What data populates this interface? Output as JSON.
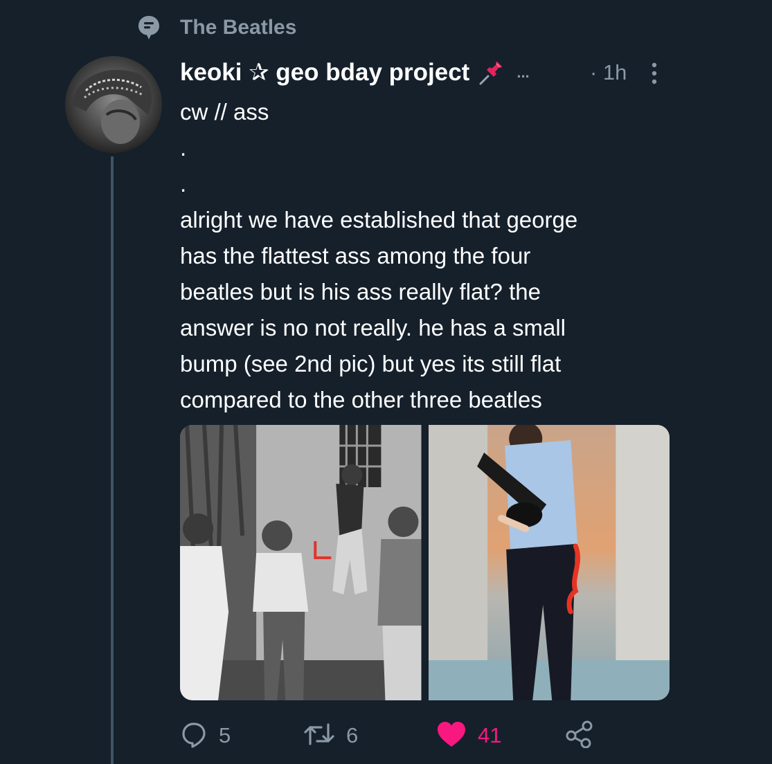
{
  "context": {
    "label": "The Beatles",
    "icon": "topic-icon"
  },
  "tweet": {
    "display_name": "keoki ✰ geo bday project",
    "name_suffix": "...",
    "time": "· 1h",
    "text_lines": [
      "cw // ass",
      ".",
      ".",
      "alright we have established that george",
      "has the flattest ass among the four",
      "beatles but is his ass really flat? the",
      "answer is no not really. he has a small",
      "bump (see 2nd pic) but yes its still flat",
      "compared to the other three beatles"
    ]
  },
  "actions": {
    "reply_count": "5",
    "retweet_count": "6",
    "like_count": "41",
    "liked": true
  },
  "colors": {
    "background": "#15202b",
    "secondary_text": "#8b98a5",
    "like": "#f91880",
    "thread_line": "#3d5466"
  }
}
